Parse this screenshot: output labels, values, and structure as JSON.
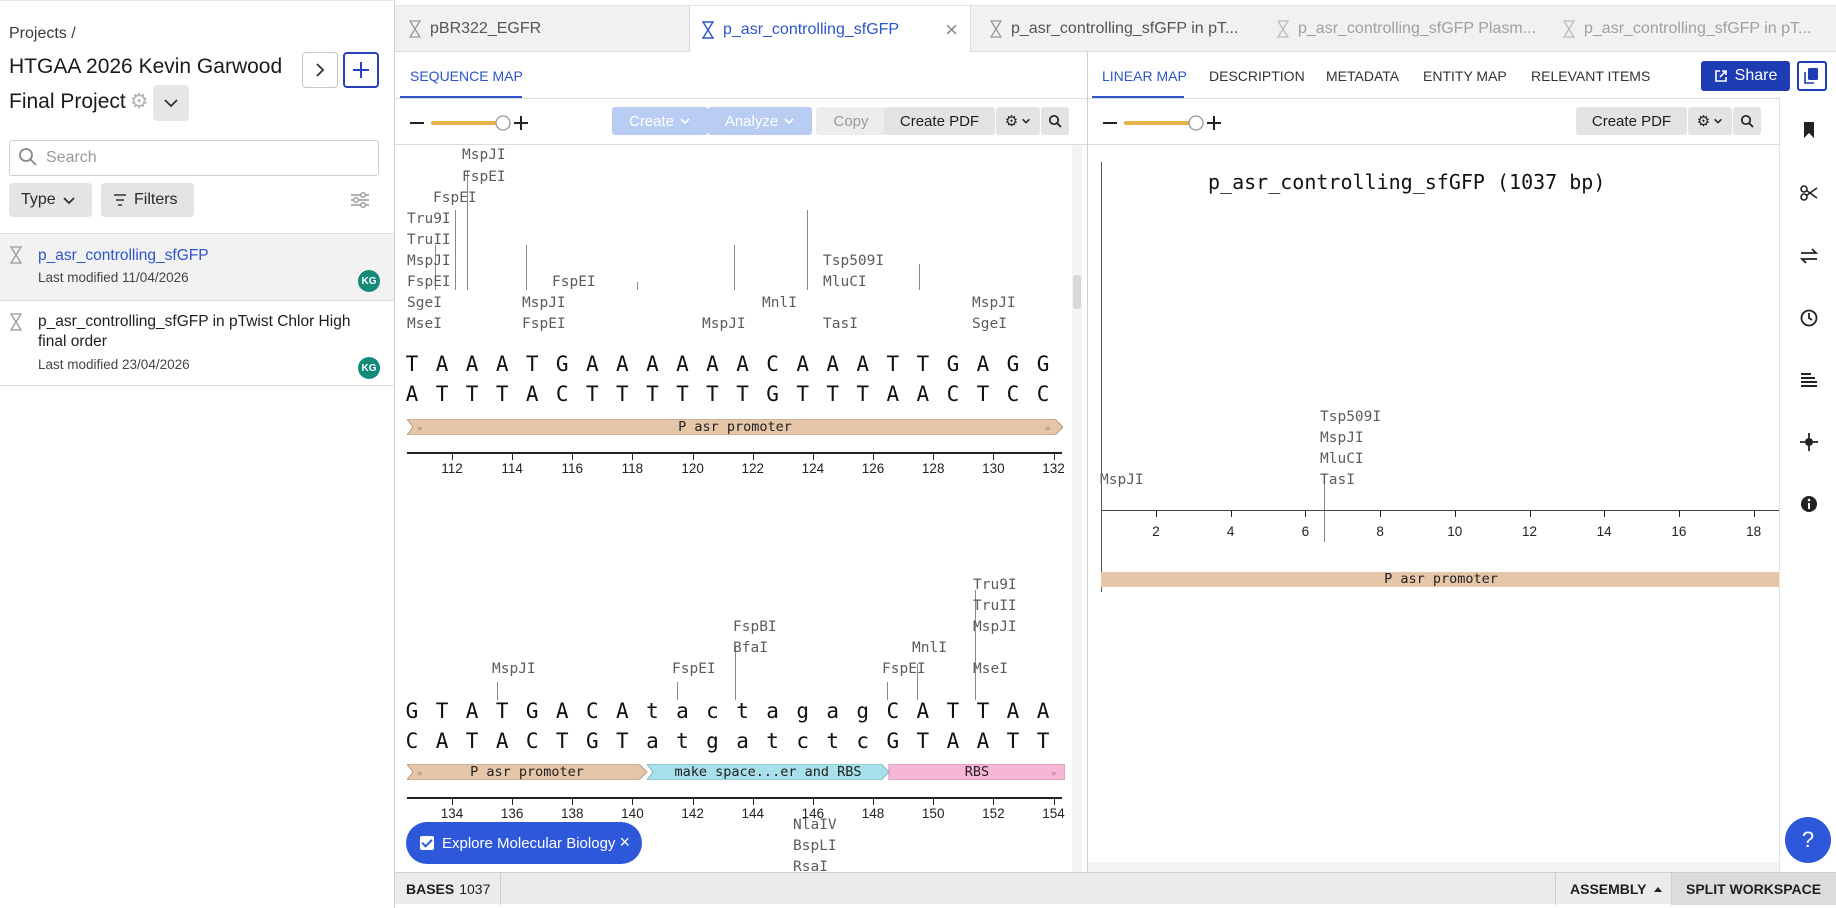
{
  "sidebar": {
    "breadcrumb": "Projects /",
    "project_title": "HTGAA 2026 Kevin Garwood Final Project",
    "search_placeholder": "Search",
    "type_label": "Type",
    "filters_label": "Filters",
    "items": [
      {
        "name": "p_asr_controlling_sfGFP",
        "modified": "Last modified 11/04/2026",
        "avatar": "KG",
        "selected": true
      },
      {
        "name": "p_asr_controlling_sfGFP in pTwist Chlor High final order",
        "modified": "Last modified 23/04/2026",
        "avatar": "KG",
        "selected": false
      }
    ]
  },
  "tabs": [
    {
      "label": "pBR322_EGFR"
    },
    {
      "label": "p_asr_controlling_sfGFP"
    },
    {
      "label": "p_asr_controlling_sfGFP in pT..."
    },
    {
      "label": "p_asr_controlling_sfGFP Plasm..."
    },
    {
      "label": "p_asr_controlling_sfGFP in pT..."
    }
  ],
  "seq_panel": {
    "tab": "SEQUENCE MAP",
    "create": "Create",
    "analyze": "Analyze",
    "copy": "Copy",
    "create_pdf": "Create PDF",
    "rows": [
      {
        "top": "TAAATGAAAAAACAAATTGAGG",
        "bottom": "ATTTACTTTTTTGTTTAACTCC",
        "features": [
          {
            "label": "P asr promoter",
            "color": "#e6c6a9"
          }
        ],
        "ruler": [
          "112",
          "114",
          "116",
          "118",
          "120",
          "122",
          "124",
          "126",
          "128",
          "130",
          "132"
        ],
        "enzymes": [
          "MspJI",
          "FspEI",
          "FspEI",
          "Tru9I",
          "TruII",
          "MspJI",
          "FspEI",
          "SgeI",
          "MseI",
          "FspEI",
          "MspJI",
          "FspEI",
          "Tsp509I",
          "MluCI",
          "MspJI",
          "MnlI",
          "TasI",
          "MspJI",
          "SgeI"
        ]
      },
      {
        "top": "GTATGACAtactagagCATTAA",
        "bottom": "CATACTGTatgatctcGTAATT",
        "features": [
          {
            "label": "P asr promoter",
            "color": "#e6c6a9"
          },
          {
            "label": "make space...er and RBS",
            "color": "#a7e0ea"
          },
          {
            "label": "RBS",
            "color": "#f7b6d3"
          }
        ],
        "ruler": [
          "134",
          "136",
          "138",
          "140",
          "142",
          "144",
          "146",
          "148",
          "150",
          "152",
          "154"
        ],
        "enzymes": [
          "Tru9I",
          "TruII",
          "FspBI",
          "MspJI",
          "BfaI",
          "MnlI",
          "MspJI",
          "FspEI",
          "FspEI",
          "MseI"
        ]
      }
    ],
    "partial_enzymes": [
      "NlaIV",
      "BspLI",
      "RsaI"
    ],
    "explore": "Explore Molecular Biology"
  },
  "right_panel": {
    "tabs": [
      "LINEAR MAP",
      "DESCRIPTION",
      "METADATA",
      "ENTITY MAP",
      "RELEVANT ITEMS"
    ],
    "share": "Share",
    "create_pdf": "Create PDF",
    "map_title": "p_asr_controlling_sfGFP (1037 bp)",
    "map_enzymes": [
      "MspJI",
      "Tsp509I",
      "MspJI",
      "MluCI",
      "TasI"
    ],
    "ruler": [
      "2",
      "4",
      "6",
      "8",
      "10",
      "12",
      "14",
      "16",
      "18"
    ],
    "feature": "P asr promoter"
  },
  "bottom": {
    "bases_label": "BASES",
    "bases_value": "1037",
    "assembly": "ASSEMBLY",
    "split": "SPLIT WORKSPACE"
  },
  "colors": {
    "accent": "#2d55c7",
    "promoter": "#e6c6a9",
    "spacer": "#a7e0ea",
    "rbs": "#f7b6d3"
  },
  "icons": [
    "hourglass-icon",
    "search-icon",
    "gear-icon",
    "chevron-right-icon",
    "plus-icon",
    "chevron-down-icon",
    "filter-icon",
    "sliders-icon",
    "close-icon",
    "bookmark-icon",
    "scissors-icon",
    "swap-icon",
    "clock-icon",
    "bars-icon",
    "crosshair-icon",
    "info-icon",
    "share-icon",
    "copy-icon",
    "help-icon"
  ]
}
